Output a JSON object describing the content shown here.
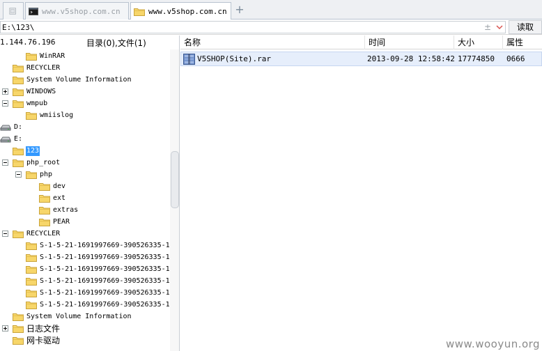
{
  "tabs": [
    {
      "label": "",
      "icon": "blank-page-icon",
      "active": false
    },
    {
      "label": "www.v5shop.com.cn",
      "icon": "console-icon",
      "active": false
    },
    {
      "label": "www.v5shop.com.cn",
      "icon": "folder-icon",
      "active": true
    }
  ],
  "address": {
    "value": "E:\\123\\",
    "stepper": "±",
    "read_label": "读取"
  },
  "left": {
    "ip": "1.144.76.196",
    "counts": "目录(0),文件(1)",
    "tree": [
      {
        "label": "WinRAR",
        "depth": 1,
        "type": "folder",
        "expander": "none"
      },
      {
        "label": "RECYCLER",
        "depth": 0,
        "type": "folder",
        "expander": "none"
      },
      {
        "label": "System Volume Information",
        "depth": 0,
        "type": "folder",
        "expander": "none"
      },
      {
        "label": "WINDOWS",
        "depth": 0,
        "type": "folder",
        "expander": "plus"
      },
      {
        "label": "wmpub",
        "depth": 0,
        "type": "folder",
        "expander": "minus"
      },
      {
        "label": "wmiislog",
        "depth": 1,
        "type": "folder",
        "expander": "none"
      },
      {
        "label": "D:",
        "depth": 0,
        "type": "drive",
        "expander": "none"
      },
      {
        "label": "E:",
        "depth": 0,
        "type": "drive",
        "expander": "none"
      },
      {
        "label": "123",
        "depth": 0,
        "type": "folder",
        "expander": "none",
        "selected": true
      },
      {
        "label": "php_root",
        "depth": 0,
        "type": "folder",
        "expander": "minus"
      },
      {
        "label": "php",
        "depth": 1,
        "type": "folder",
        "expander": "minus"
      },
      {
        "label": "dev",
        "depth": 2,
        "type": "folder",
        "expander": "none"
      },
      {
        "label": "ext",
        "depth": 2,
        "type": "folder",
        "expander": "none"
      },
      {
        "label": "extras",
        "depth": 2,
        "type": "folder",
        "expander": "none"
      },
      {
        "label": "PEAR",
        "depth": 2,
        "type": "folder",
        "expander": "none"
      },
      {
        "label": "RECYCLER",
        "depth": 0,
        "type": "folder",
        "expander": "minus"
      },
      {
        "label": "S-1-5-21-1691997669-390526335-1",
        "depth": 1,
        "type": "folder",
        "expander": "none"
      },
      {
        "label": "S-1-5-21-1691997669-390526335-1",
        "depth": 1,
        "type": "folder",
        "expander": "none"
      },
      {
        "label": "S-1-5-21-1691997669-390526335-1",
        "depth": 1,
        "type": "folder",
        "expander": "none"
      },
      {
        "label": "S-1-5-21-1691997669-390526335-1",
        "depth": 1,
        "type": "folder",
        "expander": "none"
      },
      {
        "label": "S-1-5-21-1691997669-390526335-1",
        "depth": 1,
        "type": "folder",
        "expander": "none"
      },
      {
        "label": "S-1-5-21-1691997669-390526335-1",
        "depth": 1,
        "type": "folder",
        "expander": "none"
      },
      {
        "label": "System Volume Information",
        "depth": 0,
        "type": "folder",
        "expander": "none"
      },
      {
        "label": "日志文件",
        "depth": 0,
        "type": "folder",
        "expander": "plus",
        "cjk": true
      },
      {
        "label": "网卡驱动",
        "depth": 0,
        "type": "folder",
        "expander": "none",
        "cjk": true
      }
    ]
  },
  "right": {
    "columns": [
      "名称",
      "时间",
      "大小",
      "属性"
    ],
    "files": [
      {
        "name": "V5SHOP(Site).rar",
        "time": "2013-09-28 12:58:42",
        "size": "17774850",
        "attr": "0666",
        "icon": "rar-archive-icon"
      }
    ]
  },
  "watermark": "www.wooyun.org",
  "colors": {
    "selection": "#3399ff",
    "folder": "#f7d66a",
    "row_highlight": "#e6eefb"
  }
}
